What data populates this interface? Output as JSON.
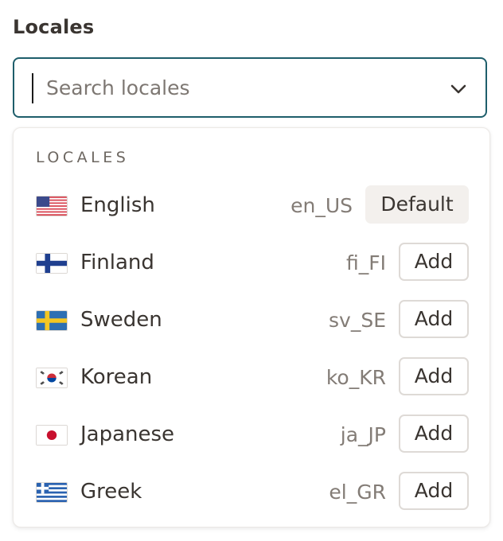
{
  "field": {
    "label": "Locales",
    "search_placeholder": "Search locales"
  },
  "icons": {
    "dropdown": "chevron-down-icon"
  },
  "colors": {
    "focus_border": "#1e5e6b",
    "default_button_bg": "#f3f0ed"
  },
  "dropdown": {
    "section_heading": "LOCALES",
    "locales": [
      {
        "name": "English",
        "code": "en_US",
        "action": "Default",
        "flag": "us-flag-icon"
      },
      {
        "name": "Finland",
        "code": "fi_FI",
        "action": "Add",
        "flag": "finland-flag-icon"
      },
      {
        "name": "Sweden",
        "code": "sv_SE",
        "action": "Add",
        "flag": "sweden-flag-icon"
      },
      {
        "name": "Korean",
        "code": "ko_KR",
        "action": "Add",
        "flag": "korea-flag-icon"
      },
      {
        "name": "Japanese",
        "code": "ja_JP",
        "action": "Add",
        "flag": "japan-flag-icon"
      },
      {
        "name": "Greek",
        "code": "el_GR",
        "action": "Add",
        "flag": "greece-flag-icon"
      }
    ]
  }
}
